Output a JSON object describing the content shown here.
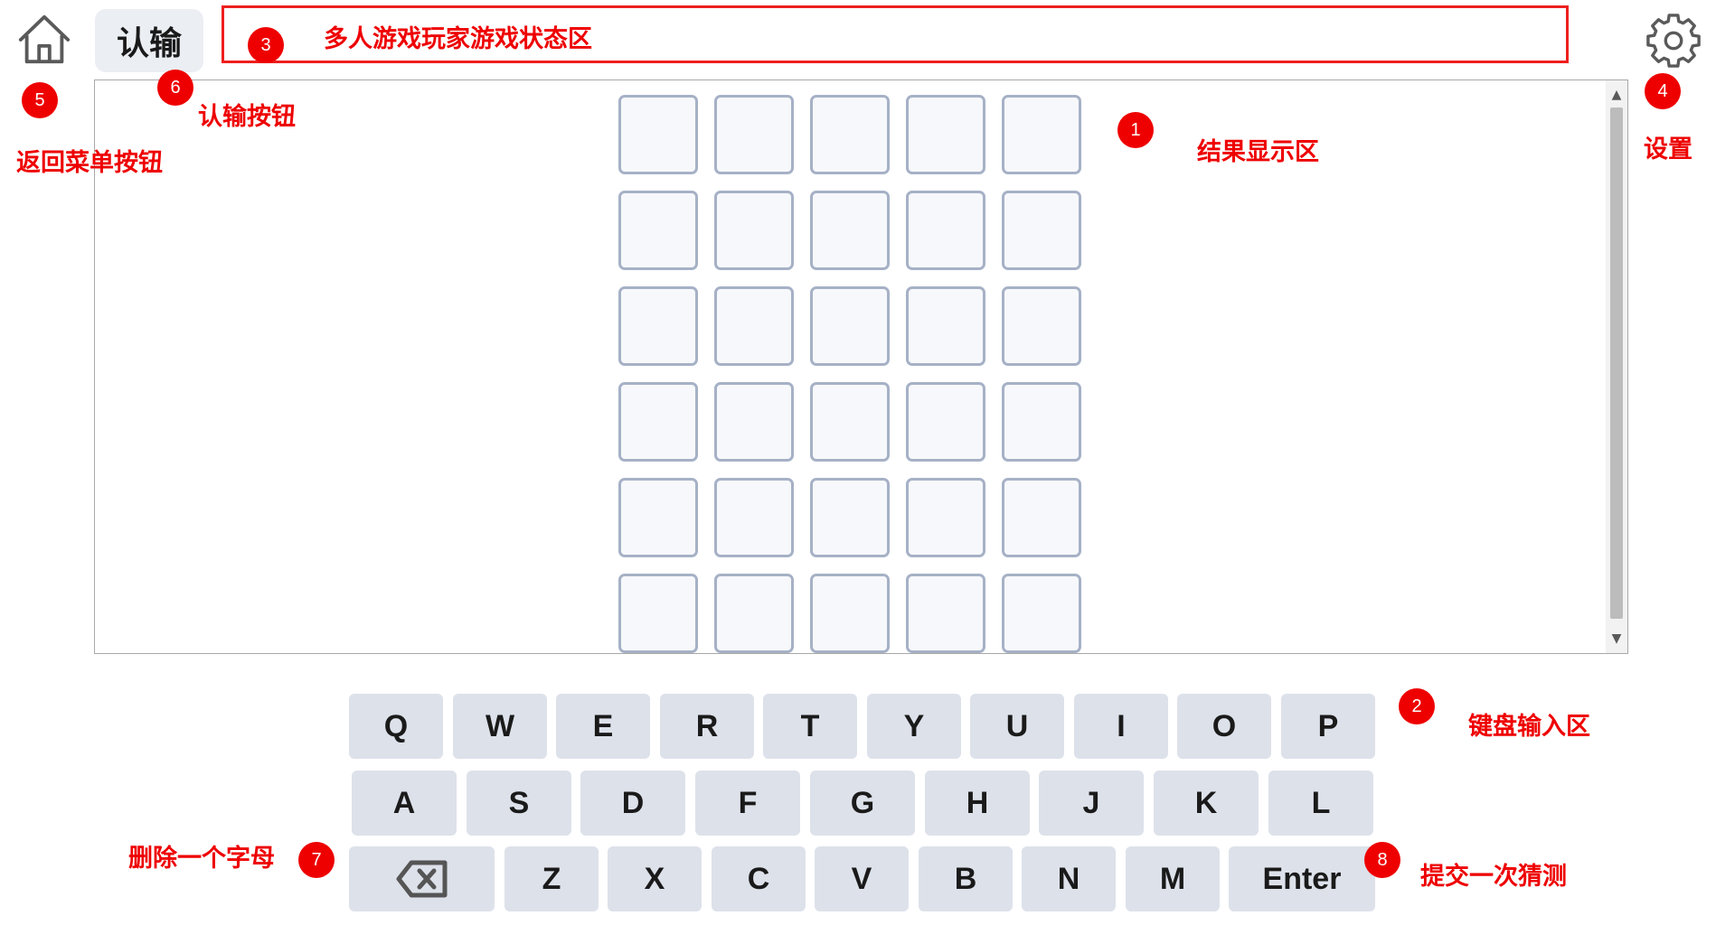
{
  "header": {
    "home_icon": "home-icon",
    "resign_label": "认输",
    "settings_icon": "gear-icon"
  },
  "board": {
    "rows": 6,
    "cols": 5
  },
  "keyboard": {
    "row1": [
      "Q",
      "W",
      "E",
      "R",
      "T",
      "Y",
      "U",
      "I",
      "O",
      "P"
    ],
    "row2": [
      "A",
      "S",
      "D",
      "F",
      "G",
      "H",
      "J",
      "K",
      "L"
    ],
    "row3": [
      "Z",
      "X",
      "C",
      "V",
      "B",
      "N",
      "M"
    ],
    "backspace_icon": "backspace-icon",
    "enter_label": "Enter"
  },
  "annotations": {
    "result_area": {
      "num": "1",
      "text": "结果显示区"
    },
    "keyboard_area": {
      "num": "2",
      "text": "键盘输入区"
    },
    "status_area": {
      "num": "3",
      "text": "多人游戏玩家游戏状态区"
    },
    "settings": {
      "num": "4",
      "text": "设置"
    },
    "home_button": {
      "num": "5",
      "text": "返回菜单按钮"
    },
    "resign_button": {
      "num": "6",
      "text": "认输按钮"
    },
    "delete_letter": {
      "num": "7",
      "text": "删除一个字母"
    },
    "submit_guess": {
      "num": "8",
      "text": "提交一次猜测"
    }
  },
  "colors": {
    "annotation": "#ee0000",
    "key_bg": "#dde1ea",
    "tile_border": "#a6b1c6"
  }
}
